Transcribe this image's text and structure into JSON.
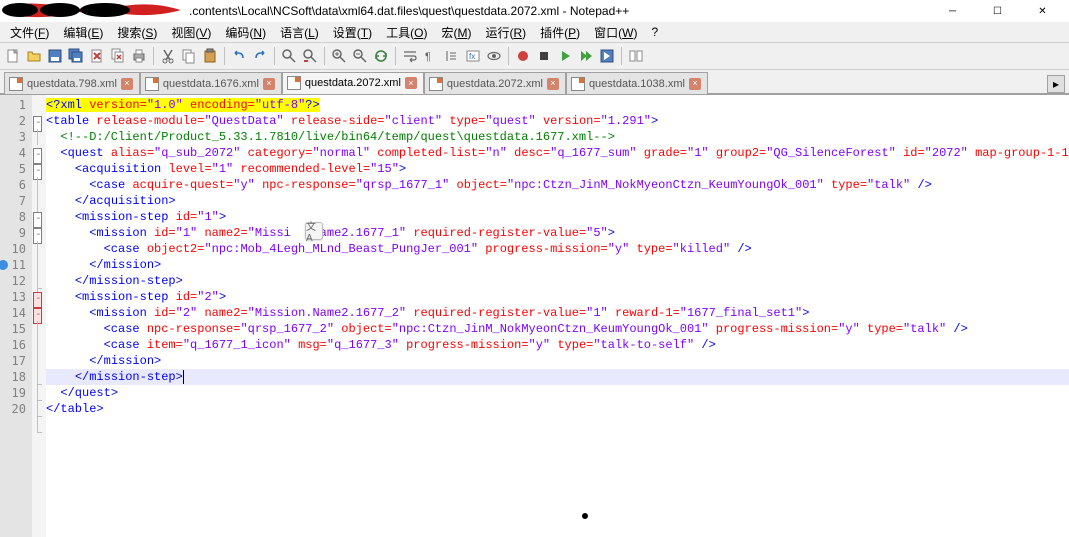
{
  "window": {
    "title": ".contents\\Local\\NCSoft\\data\\xml64.dat.files\\quest\\questdata.2072.xml - Notepad++"
  },
  "menus": [
    {
      "label": "文件",
      "key": "F"
    },
    {
      "label": "编辑",
      "key": "E"
    },
    {
      "label": "搜索",
      "key": "S"
    },
    {
      "label": "视图",
      "key": "V"
    },
    {
      "label": "编码",
      "key": "N"
    },
    {
      "label": "语言",
      "key": "L"
    },
    {
      "label": "设置",
      "key": "T"
    },
    {
      "label": "工具",
      "key": "O"
    },
    {
      "label": "宏",
      "key": "M"
    },
    {
      "label": "运行",
      "key": "R"
    },
    {
      "label": "插件",
      "key": "P"
    },
    {
      "label": "窗口",
      "key": "W"
    },
    {
      "label": "?",
      "key": ""
    }
  ],
  "tabs": [
    {
      "label": "questdata.798.xml",
      "active": false
    },
    {
      "label": "questdata.1676.xml",
      "active": false
    },
    {
      "label": "questdata.2072.xml",
      "active": true
    },
    {
      "label": "questdata.2072.xml",
      "active": false
    },
    {
      "label": "questdata.1038.xml",
      "active": false
    }
  ],
  "toolbar_icons": [
    "new",
    "open",
    "save",
    "save-all",
    "close",
    "close-all",
    "print",
    "sep",
    "cut",
    "copy",
    "paste",
    "sep",
    "undo",
    "redo",
    "sep",
    "find",
    "replace",
    "sep",
    "zoom-in",
    "zoom-out",
    "sync",
    "sep",
    "wrap",
    "show-all",
    "indent-guide",
    "lang",
    "eye",
    "sep",
    "record",
    "stop",
    "play",
    "play-multi",
    "save-macro",
    "sep",
    "compare"
  ],
  "code": {
    "lines": 20,
    "highlighted_line": 18,
    "bookmark_line": 11,
    "tokens": [
      [
        {
          "t": "pi",
          "v": "<?"
        },
        {
          "t": "pi",
          "v": "xml "
        },
        {
          "t": "piattr",
          "v": "version="
        },
        {
          "t": "pistr",
          "v": "\"1.0\""
        },
        {
          "t": "pi",
          "v": " "
        },
        {
          "t": "piattr",
          "v": "encoding="
        },
        {
          "t": "pistr",
          "v": "\"utf-8\""
        },
        {
          "t": "pi",
          "v": "?>"
        }
      ],
      [
        {
          "t": "tag",
          "v": "<table "
        },
        {
          "t": "attr",
          "v": "release-module="
        },
        {
          "t": "str",
          "v": "\"QuestData\""
        },
        {
          "t": "tag",
          "v": " "
        },
        {
          "t": "attr",
          "v": "release-side="
        },
        {
          "t": "str",
          "v": "\"client\""
        },
        {
          "t": "tag",
          "v": " "
        },
        {
          "t": "attr",
          "v": "type="
        },
        {
          "t": "str",
          "v": "\"quest\""
        },
        {
          "t": "tag",
          "v": " "
        },
        {
          "t": "attr",
          "v": "version="
        },
        {
          "t": "str",
          "v": "\"1.291\""
        },
        {
          "t": "tag",
          "v": ">"
        }
      ],
      [
        {
          "t": "comment",
          "v": "  <!--D:/Client/Product_5.33.1.7810/live/bin64/temp/quest\\questdata.1677.xml-->"
        }
      ],
      [
        {
          "t": "txt",
          "v": "  "
        },
        {
          "t": "tag",
          "v": "<quest "
        },
        {
          "t": "attr",
          "v": "alias="
        },
        {
          "t": "str",
          "v": "\"q_sub_2072\""
        },
        {
          "t": "tag",
          "v": " "
        },
        {
          "t": "attr",
          "v": "category="
        },
        {
          "t": "str",
          "v": "\"normal\""
        },
        {
          "t": "tag",
          "v": " "
        },
        {
          "t": "attr",
          "v": "completed-list="
        },
        {
          "t": "str",
          "v": "\"n\""
        },
        {
          "t": "tag",
          "v": " "
        },
        {
          "t": "attr",
          "v": "desc="
        },
        {
          "t": "str",
          "v": "\"q_1677_sum\""
        },
        {
          "t": "tag",
          "v": " "
        },
        {
          "t": "attr",
          "v": "grade="
        },
        {
          "t": "str",
          "v": "\"1\""
        },
        {
          "t": "tag",
          "v": " "
        },
        {
          "t": "attr",
          "v": "group2="
        },
        {
          "t": "str",
          "v": "\"QG_SilenceForest\""
        },
        {
          "t": "tag",
          "v": " "
        },
        {
          "t": "attr",
          "v": "id="
        },
        {
          "t": "str",
          "v": "\"2072\""
        },
        {
          "t": "tag",
          "v": " "
        },
        {
          "t": "attr",
          "v": "map-group-1-1="
        }
      ],
      [
        {
          "t": "txt",
          "v": "    "
        },
        {
          "t": "tag",
          "v": "<acquisition "
        },
        {
          "t": "attr",
          "v": "level="
        },
        {
          "t": "str",
          "v": "\"1\""
        },
        {
          "t": "tag",
          "v": " "
        },
        {
          "t": "attr",
          "v": "recommended-level="
        },
        {
          "t": "str",
          "v": "\"15\""
        },
        {
          "t": "tag",
          "v": ">"
        }
      ],
      [
        {
          "t": "txt",
          "v": "      "
        },
        {
          "t": "tag",
          "v": "<case "
        },
        {
          "t": "attr",
          "v": "acquire-quest="
        },
        {
          "t": "str",
          "v": "\"y\""
        },
        {
          "t": "tag",
          "v": " "
        },
        {
          "t": "attr",
          "v": "npc-response="
        },
        {
          "t": "str",
          "v": "\"qrsp_1677_1\""
        },
        {
          "t": "tag",
          "v": " "
        },
        {
          "t": "attr",
          "v": "object="
        },
        {
          "t": "str",
          "v": "\"npc:Ctzn_JinM_NokMyeonCtzn_KeumYoungOk_001\""
        },
        {
          "t": "tag",
          "v": " "
        },
        {
          "t": "attr",
          "v": "type="
        },
        {
          "t": "str",
          "v": "\"talk\""
        },
        {
          "t": "tag",
          "v": " />"
        }
      ],
      [
        {
          "t": "txt",
          "v": "    "
        },
        {
          "t": "tag",
          "v": "</acquisition>"
        }
      ],
      [
        {
          "t": "txt",
          "v": "    "
        },
        {
          "t": "tag",
          "v": "<mission-step "
        },
        {
          "t": "attr",
          "v": "id="
        },
        {
          "t": "str",
          "v": "\"1\""
        },
        {
          "t": "tag",
          "v": ">"
        }
      ],
      [
        {
          "t": "txt",
          "v": "      "
        },
        {
          "t": "tag",
          "v": "<mission "
        },
        {
          "t": "attr",
          "v": "id="
        },
        {
          "t": "str",
          "v": "\"1\""
        },
        {
          "t": "tag",
          "v": " "
        },
        {
          "t": "attr",
          "v": "name2="
        },
        {
          "t": "str",
          "v": "\"Missi   Name2.1677_1\""
        },
        {
          "t": "tag",
          "v": " "
        },
        {
          "t": "attr",
          "v": "required-register-value="
        },
        {
          "t": "str",
          "v": "\"5\""
        },
        {
          "t": "tag",
          "v": ">"
        }
      ],
      [
        {
          "t": "txt",
          "v": "        "
        },
        {
          "t": "tag",
          "v": "<case "
        },
        {
          "t": "attr",
          "v": "object2="
        },
        {
          "t": "str",
          "v": "\"npc:Mob_4Legh_MLnd_Beast_PungJer_001\""
        },
        {
          "t": "tag",
          "v": " "
        },
        {
          "t": "attr",
          "v": "progress-mission="
        },
        {
          "t": "str",
          "v": "\"y\""
        },
        {
          "t": "tag",
          "v": " "
        },
        {
          "t": "attr",
          "v": "type="
        },
        {
          "t": "str",
          "v": "\"killed\""
        },
        {
          "t": "tag",
          "v": " />"
        }
      ],
      [
        {
          "t": "txt",
          "v": "      "
        },
        {
          "t": "tag",
          "v": "</mission>"
        }
      ],
      [
        {
          "t": "txt",
          "v": "    "
        },
        {
          "t": "tag",
          "v": "</mission-step>"
        }
      ],
      [
        {
          "t": "txt",
          "v": "    "
        },
        {
          "t": "tag",
          "v": "<mission-step "
        },
        {
          "t": "attr",
          "v": "id="
        },
        {
          "t": "str",
          "v": "\"2\""
        },
        {
          "t": "tag",
          "v": ">"
        }
      ],
      [
        {
          "t": "txt",
          "v": "      "
        },
        {
          "t": "tag",
          "v": "<mission "
        },
        {
          "t": "attr",
          "v": "id="
        },
        {
          "t": "str",
          "v": "\"2\""
        },
        {
          "t": "tag",
          "v": " "
        },
        {
          "t": "attr",
          "v": "name2="
        },
        {
          "t": "str",
          "v": "\"Mission.Name2.1677_2\""
        },
        {
          "t": "tag",
          "v": " "
        },
        {
          "t": "attr",
          "v": "required-register-value="
        },
        {
          "t": "str",
          "v": "\"1\""
        },
        {
          "t": "tag",
          "v": " "
        },
        {
          "t": "attr",
          "v": "reward-1="
        },
        {
          "t": "str",
          "v": "\"1677_final_set1\""
        },
        {
          "t": "tag",
          "v": ">"
        }
      ],
      [
        {
          "t": "txt",
          "v": "        "
        },
        {
          "t": "tag",
          "v": "<case "
        },
        {
          "t": "attr",
          "v": "npc-response="
        },
        {
          "t": "str",
          "v": "\"qrsp_1677_2\""
        },
        {
          "t": "tag",
          "v": " "
        },
        {
          "t": "attr",
          "v": "object="
        },
        {
          "t": "str",
          "v": "\"npc:Ctzn_JinM_NokMyeonCtzn_KeumYoungOk_001\""
        },
        {
          "t": "tag",
          "v": " "
        },
        {
          "t": "attr",
          "v": "progress-mission="
        },
        {
          "t": "str",
          "v": "\"y\""
        },
        {
          "t": "tag",
          "v": " "
        },
        {
          "t": "attr",
          "v": "type="
        },
        {
          "t": "str",
          "v": "\"talk\""
        },
        {
          "t": "tag",
          "v": " />"
        }
      ],
      [
        {
          "t": "txt",
          "v": "        "
        },
        {
          "t": "tag",
          "v": "<case "
        },
        {
          "t": "attr",
          "v": "item="
        },
        {
          "t": "str",
          "v": "\"q_1677_1_icon\""
        },
        {
          "t": "tag",
          "v": " "
        },
        {
          "t": "attr",
          "v": "msg="
        },
        {
          "t": "str",
          "v": "\"q_1677_3\""
        },
        {
          "t": "tag",
          "v": " "
        },
        {
          "t": "attr",
          "v": "progress-mission="
        },
        {
          "t": "str",
          "v": "\"y\""
        },
        {
          "t": "tag",
          "v": " "
        },
        {
          "t": "attr",
          "v": "type="
        },
        {
          "t": "str",
          "v": "\"talk-to-self\""
        },
        {
          "t": "tag",
          "v": " />"
        }
      ],
      [
        {
          "t": "txt",
          "v": "      "
        },
        {
          "t": "tag",
          "v": "</mission>"
        }
      ],
      [
        {
          "t": "txt",
          "v": "    "
        },
        {
          "t": "tag",
          "v": "</mission-step>"
        },
        {
          "t": "cursor",
          "v": ""
        }
      ],
      [
        {
          "t": "txt",
          "v": "  "
        },
        {
          "t": "tag",
          "v": "</quest>"
        }
      ],
      [
        {
          "t": "tag",
          "v": "</table>"
        }
      ]
    ],
    "fold": [
      {
        "type": "none"
      },
      {
        "type": "box"
      },
      {
        "type": "line"
      },
      {
        "type": "box"
      },
      {
        "type": "box"
      },
      {
        "type": "line"
      },
      {
        "type": "end"
      },
      {
        "type": "box"
      },
      {
        "type": "box"
      },
      {
        "type": "line"
      },
      {
        "type": "end"
      },
      {
        "type": "end"
      },
      {
        "type": "boxred"
      },
      {
        "type": "boxred"
      },
      {
        "type": "line"
      },
      {
        "type": "line"
      },
      {
        "type": "end"
      },
      {
        "type": "end"
      },
      {
        "type": "end"
      },
      {
        "type": "end"
      }
    ]
  }
}
